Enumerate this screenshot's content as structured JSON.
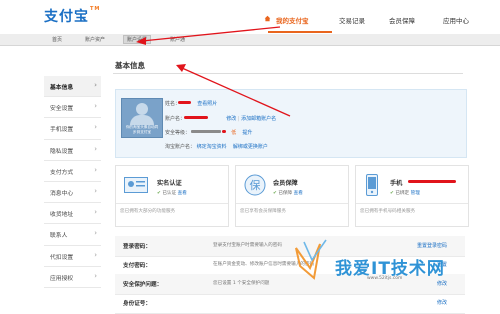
{
  "header": {
    "logo": "支付宝",
    "logo_mark": "TM",
    "nav": [
      "我的支付宝",
      "交易记录",
      "会员保障",
      "应用中心"
    ]
  },
  "subnav": [
    "首页",
    "账户资产",
    "账户设置",
    "账户通"
  ],
  "sidebar": [
    "基本信息",
    "安全设置",
    "手机设置",
    "隐私设置",
    "支付方式",
    "消息中心",
    "收货地址",
    "联系人",
    "代扣设置",
    "应用授权"
  ],
  "section_title": "基本信息",
  "profile": {
    "avatar_text": "你的淘宝头像自动同步到支付宝",
    "name_label": "姓名：",
    "name_link": "查看照片",
    "account_label": "账户名：",
    "account_links": [
      "修改",
      "添加邮箱账户名"
    ],
    "reg_label": "安全等级：",
    "reg_level": "低",
    "reg_link": "提升",
    "taobao_label": "淘宝账户名：",
    "taobao_links": [
      "绑定淘宝资料",
      "解绑或更换账户"
    ]
  },
  "cards": [
    {
      "title": "实名认证",
      "status": "已认证",
      "link": "查看",
      "note": "您已拥有大部分的功能服务"
    },
    {
      "title": "会员保障",
      "status": "已保障",
      "link": "查看",
      "note": "您已享有会员保障服务"
    },
    {
      "title": "手机",
      "status": "已绑定",
      "link": "管理",
      "note": "您已拥有手机号码相关服务"
    }
  ],
  "security": [
    {
      "label": "登录密码：",
      "desc": "登录支付宝账户时需要输入的密码",
      "action": "重置登录密码"
    },
    {
      "label": "支付密码：",
      "desc": "在账户资金变动、修改账户信息时需要输入的密码",
      "action": "重置"
    },
    {
      "label": "安全保护问题：",
      "desc": "您已设置 1 个安全保护问题",
      "action": "修改"
    },
    {
      "label": "身份证号：",
      "desc": "",
      "action": "修改"
    }
  ],
  "watermark": {
    "text": "我爱IT技术网",
    "sub": "www.52itjs.com"
  },
  "colors": {
    "accent": "#e9651d",
    "brand": "#1a6fc4",
    "arrow": "#e1141b"
  }
}
